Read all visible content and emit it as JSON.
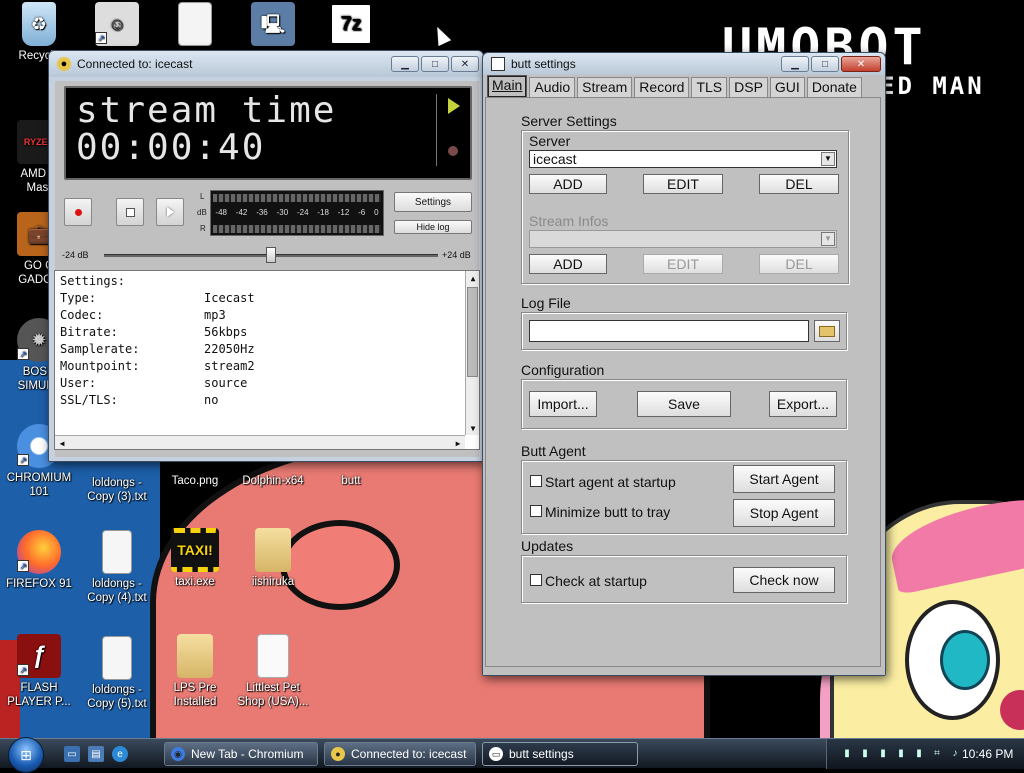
{
  "desktop": {
    "logo_line1": "UMOBOT",
    "logo_line2": "ED MAN",
    "icons": [
      {
        "label": "Recycle"
      },
      {
        "label": ""
      },
      {
        "label": ""
      },
      {
        "label": ""
      },
      {
        "label": "7z",
        "glyph": "7z"
      },
      {
        "label": "AMD R\nMast",
        "glyph": "RYZEN"
      },
      {
        "label": "GO G\nGADGE"
      },
      {
        "label": "BOSN\nSIMULA"
      },
      {
        "label": "CHROMIUM\n101"
      },
      {
        "label": "FIREFOX 91"
      },
      {
        "label": "FLASH\nPLAYER P..."
      },
      {
        "label": "loldongs -\nCopy (3).txt"
      },
      {
        "label": "Taco.png"
      },
      {
        "label": "Dolphin-x64"
      },
      {
        "label": "butt"
      },
      {
        "label": "loldongs -\nCopy (4).txt"
      },
      {
        "label": "taxi.exe",
        "glyph": "TAXI!"
      },
      {
        "label": "iishiruka"
      },
      {
        "label": "loldongs -\nCopy (5).txt"
      },
      {
        "label": "LPS Pre\nInstalled"
      },
      {
        "label": "Littlest Pet\nShop (USA)..."
      }
    ]
  },
  "main_window": {
    "title": "Connected to: icecast",
    "lcd": {
      "line1": "stream time",
      "line2": "00:00:40"
    },
    "vu": {
      "left_label": "L",
      "right_label": "R",
      "db_label": "dB",
      "scale": [
        "-48",
        "-42",
        "-36",
        "-30",
        "-24",
        "-18",
        "-12",
        "-6",
        "0"
      ]
    },
    "settings_button": "Settings",
    "hide_log_button": "Hide log",
    "gain": {
      "min_label": "-24 dB",
      "max_label": "+24 dB",
      "value_fraction": 0.5
    },
    "log": {
      "heading": "Settings:",
      "rows": [
        {
          "key": "Type:",
          "value": "Icecast"
        },
        {
          "key": "Codec:",
          "value": "mp3"
        },
        {
          "key": "Bitrate:",
          "value": "56kbps"
        },
        {
          "key": "Samplerate:",
          "value": "22050Hz"
        },
        {
          "key": "Mountpoint:",
          "value": "stream2"
        },
        {
          "key": "User:",
          "value": "source"
        },
        {
          "key": "SSL/TLS:",
          "value": "no"
        }
      ]
    }
  },
  "settings_window": {
    "title": "butt settings",
    "tabs": [
      "Main",
      "Audio",
      "Stream",
      "Record",
      "TLS",
      "DSP",
      "GUI",
      "Donate"
    ],
    "active_tab": "Main",
    "server_settings": {
      "group_title": "Server Settings",
      "server_label": "Server",
      "server_value": "icecast",
      "add": "ADD",
      "edit": "EDIT",
      "del": "DEL",
      "stream_infos_label": "Stream Infos",
      "stream_infos_value": ""
    },
    "log_file": {
      "group_title": "Log File",
      "value": ""
    },
    "configuration": {
      "group_title": "Configuration",
      "import": "Import...",
      "save": "Save",
      "export": "Export..."
    },
    "butt_agent": {
      "group_title": "Butt Agent",
      "start_at_startup": "Start agent at startup",
      "minimize_to_tray": "Minimize butt to tray",
      "start_agent": "Start Agent",
      "stop_agent": "Stop Agent"
    },
    "updates": {
      "group_title": "Updates",
      "check_at_startup": "Check at startup",
      "check_now": "Check now"
    }
  },
  "taskbar": {
    "tasks": [
      {
        "label": "New Tab - Chromium"
      },
      {
        "label": "Connected to: icecast"
      },
      {
        "label": "butt settings"
      }
    ],
    "clock": "10:46 PM"
  },
  "colors": {
    "lcd_accent": "#c4d33b",
    "dialog_gray": "#c0c0c0",
    "record_red": "#dd1111"
  }
}
